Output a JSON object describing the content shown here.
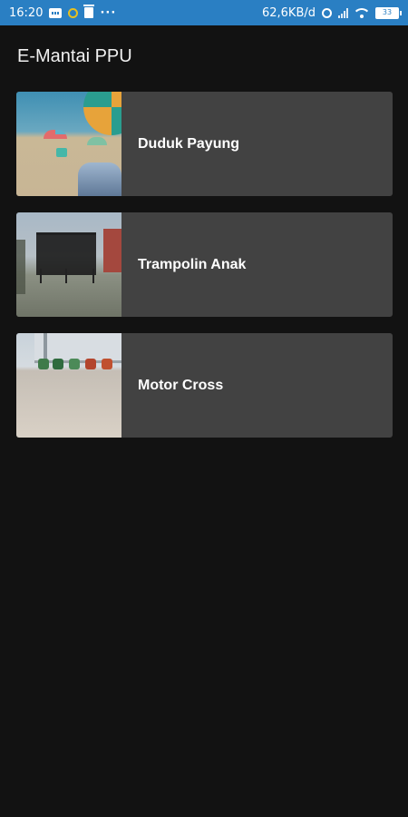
{
  "status_bar": {
    "time": "16:20",
    "network_speed": "62,6KB/d",
    "battery_level": "33",
    "icons": [
      "message-icon",
      "notification-circle-icon",
      "trash-icon",
      "more-dots-icon",
      "alarm-icon",
      "signal-icon",
      "wifi-icon",
      "battery-icon"
    ]
  },
  "app": {
    "title": "E-Mantai PPU"
  },
  "items": [
    {
      "label": "Duduk Payung"
    },
    {
      "label": "Trampolin Anak"
    },
    {
      "label": "Motor Cross"
    }
  ],
  "colors": {
    "status_bar": "#2a7fc3",
    "background": "#121212",
    "card": "#424242",
    "text": "#ffffff"
  }
}
